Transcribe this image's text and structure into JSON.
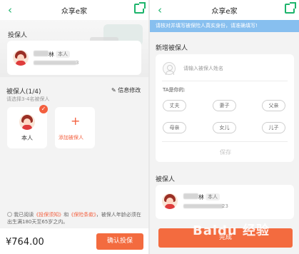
{
  "left": {
    "title": "众享e家",
    "applicant_section": "投保人",
    "applicant_name": "林",
    "applicant_tag": "本人",
    "applicant_id_tail": "3",
    "insured_section": "被保人(1/4)",
    "insured_hint": "请选择3-4名被保人",
    "edit_info": "信息修改",
    "self_label": "本人",
    "add_insured": "添加被保人",
    "agreement_prefix": "我已阅读",
    "notice_link": "《投保须知》",
    "and_text": "和",
    "terms_link": "《保险条款》",
    "agreement_suffix": "，被保人年龄必须在",
    "agreement_line2": "出生满180天至65岁之内。",
    "price": "¥764.00",
    "confirm": "确认投保"
  },
  "right": {
    "title": "众享e家",
    "notice": "请核对并填写被保险人真实身份，请准确填写!",
    "new_section": "新增被保人",
    "name_placeholder": "请输入被保人姓名",
    "relation_label": "TA是你的:",
    "relations": [
      "丈夫",
      "妻子",
      "父亲",
      "母亲",
      "女儿",
      "儿子"
    ],
    "save": "保存",
    "insured_section": "被保人",
    "insured_name": "林",
    "insured_tag": "本人",
    "insured_id_tail": "23",
    "finish": "完成"
  },
  "watermark": "Baidu 经验",
  "colors": {
    "accent_green": "#1cb46b",
    "accent_orange": "#f36b3f",
    "notice_blue": "#87bfef"
  }
}
